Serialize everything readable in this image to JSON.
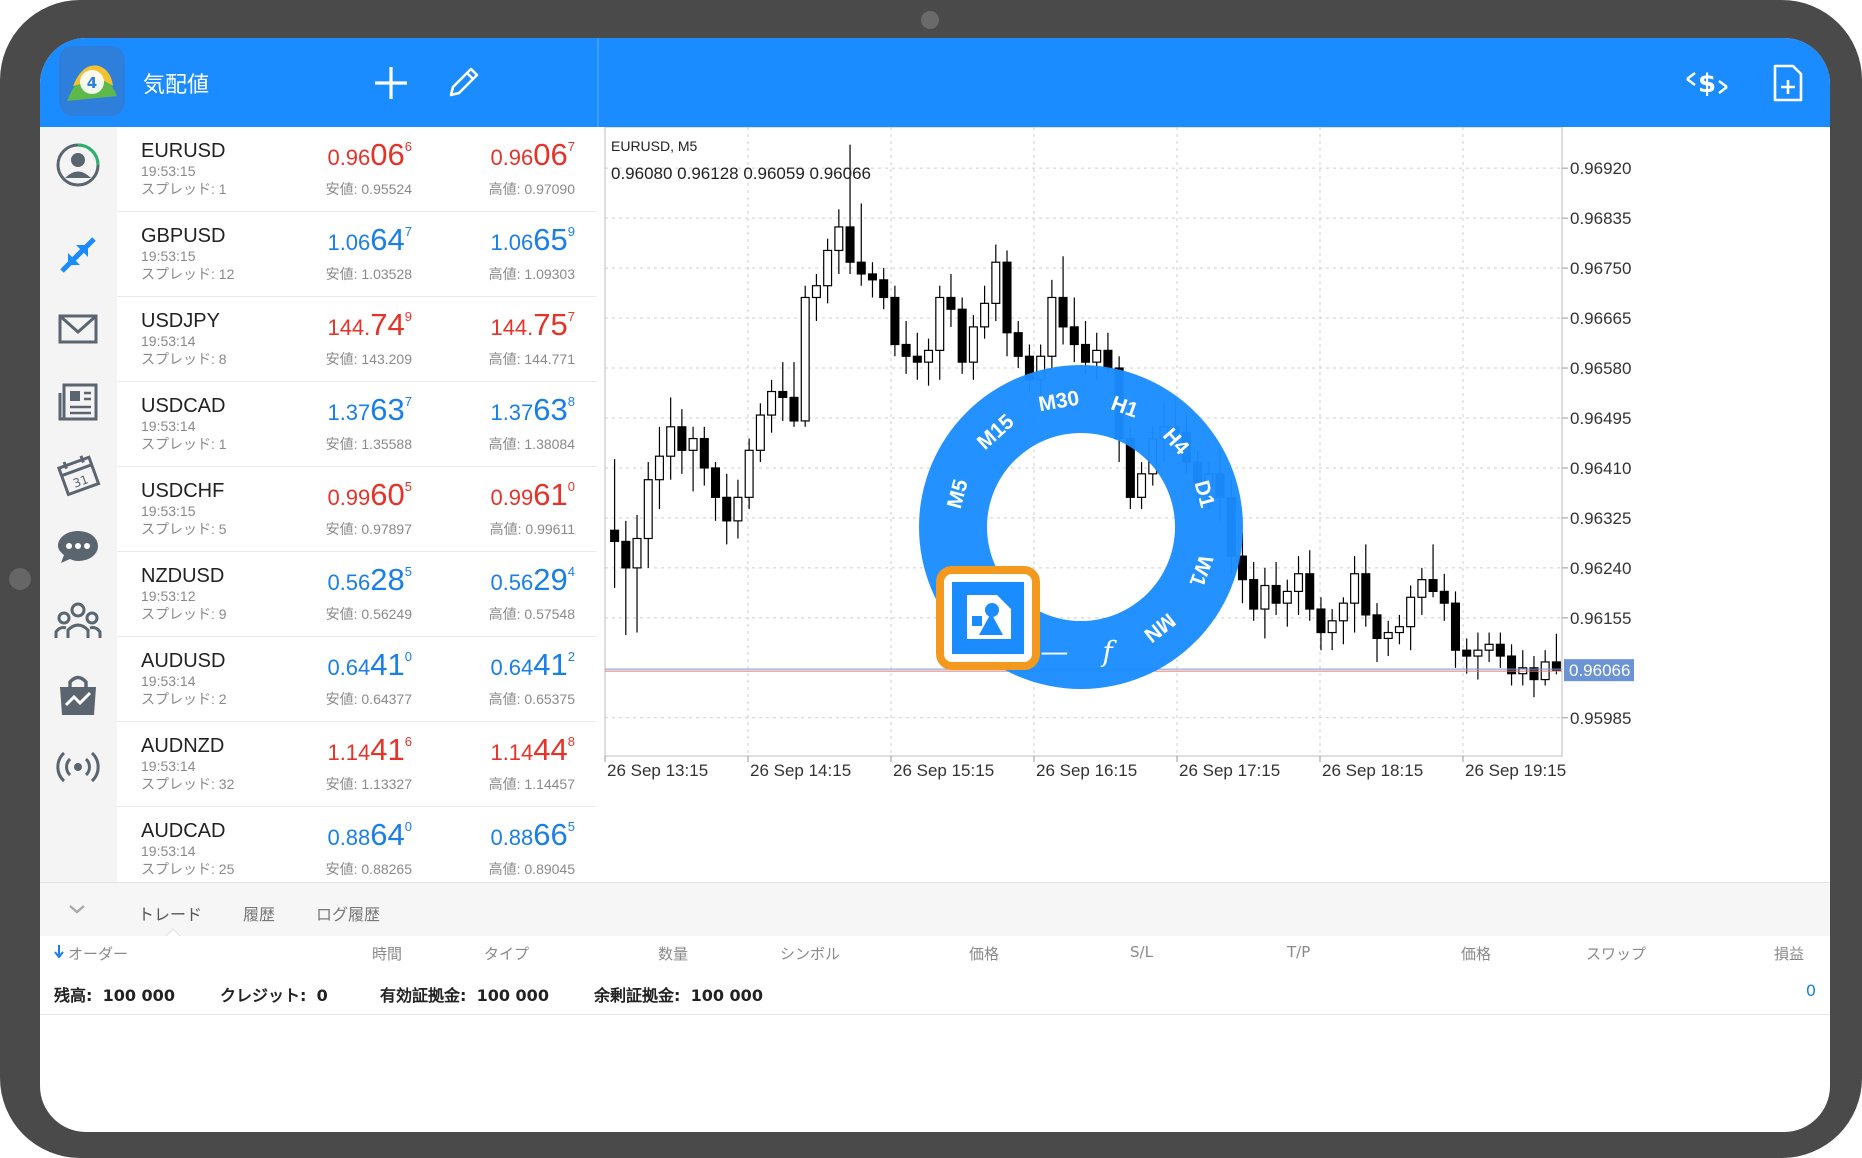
{
  "header": {
    "title": "気配値"
  },
  "quotes": [
    {
      "symbol": "EURUSD",
      "time": "19:53:15",
      "spread": "スプレッド: 1",
      "dir": "red",
      "bid": {
        "a": "0.96",
        "b": "06",
        "c": "6"
      },
      "ask": {
        "a": "0.96",
        "b": "06",
        "c": "7"
      },
      "low": "安値: 0.95524",
      "high": "高値: 0.97090"
    },
    {
      "symbol": "GBPUSD",
      "time": "19:53:15",
      "spread": "スプレッド: 12",
      "dir": "blue",
      "bid": {
        "a": "1.06",
        "b": "64",
        "c": "7"
      },
      "ask": {
        "a": "1.06",
        "b": "65",
        "c": "9"
      },
      "low": "安値: 1.03528",
      "high": "高値: 1.09303"
    },
    {
      "symbol": "USDJPY",
      "time": "19:53:14",
      "spread": "スプレッド: 8",
      "dir": "red",
      "bid": {
        "a": "144.",
        "b": "74",
        "c": "9"
      },
      "ask": {
        "a": "144.",
        "b": "75",
        "c": "7"
      },
      "low": "安値: 143.209",
      "high": "高値: 144.771"
    },
    {
      "symbol": "USDCAD",
      "time": "19:53:14",
      "spread": "スプレッド: 1",
      "dir": "blue",
      "bid": {
        "a": "1.37",
        "b": "63",
        "c": "7"
      },
      "ask": {
        "a": "1.37",
        "b": "63",
        "c": "8"
      },
      "low": "安値: 1.35588",
      "high": "高値: 1.38084"
    },
    {
      "symbol": "USDCHF",
      "time": "19:53:15",
      "spread": "スプレッド: 5",
      "dir": "red",
      "bid": {
        "a": "0.99",
        "b": "60",
        "c": "5"
      },
      "ask": {
        "a": "0.99",
        "b": "61",
        "c": "0"
      },
      "low": "安値: 0.97897",
      "high": "高値: 0.99611"
    },
    {
      "symbol": "NZDUSD",
      "time": "19:53:12",
      "spread": "スプレッド: 9",
      "dir": "blue",
      "bid": {
        "a": "0.56",
        "b": "28",
        "c": "5"
      },
      "ask": {
        "a": "0.56",
        "b": "29",
        "c": "4"
      },
      "low": "安値: 0.56249",
      "high": "高値: 0.57548"
    },
    {
      "symbol": "AUDUSD",
      "time": "19:53:14",
      "spread": "スプレッド: 2",
      "dir": "blue",
      "bid": {
        "a": "0.64",
        "b": "41",
        "c": "0"
      },
      "ask": {
        "a": "0.64",
        "b": "41",
        "c": "2"
      },
      "low": "安値: 0.64377",
      "high": "高値: 0.65375"
    },
    {
      "symbol": "AUDNZD",
      "time": "19:53:14",
      "spread": "スプレッド: 32",
      "dir": "red",
      "bid": {
        "a": "1.14",
        "b": "41",
        "c": "6"
      },
      "ask": {
        "a": "1.14",
        "b": "44",
        "c": "8"
      },
      "low": "安値: 1.13327",
      "high": "高値: 1.14457"
    },
    {
      "symbol": "AUDCAD",
      "time": "19:53:14",
      "spread": "スプレッド: 25",
      "dir": "blue",
      "bid": {
        "a": "0.88",
        "b": "64",
        "c": "0"
      },
      "ask": {
        "a": "0.88",
        "b": "66",
        "c": "5"
      },
      "low": "安値: 0.88265",
      "high": "高値: 0.89045"
    }
  ],
  "chart": {
    "symbol_label": "EURUSD, M5",
    "ohlc_label": "0.96080 0.96128 0.96059 0.96066",
    "current_price_label": "0.96066",
    "timeframes": [
      "M5",
      "M15",
      "M30",
      "H1",
      "H4",
      "D1",
      "W1",
      "MN"
    ],
    "wheel_tools": [
      "—",
      "f"
    ]
  },
  "chart_data": {
    "type": "candlestick",
    "title": "EURUSD, M5",
    "xlabel": "",
    "ylabel": "",
    "ylim": [
      0.9592,
      0.9699
    ],
    "y_ticks": [
      0.9692,
      0.96835,
      0.9675,
      0.96665,
      0.9658,
      0.96495,
      0.9641,
      0.96325,
      0.9624,
      0.96155,
      0.96066,
      0.95985
    ],
    "y_tick_labels": [
      "0.96920",
      "0.96835",
      "0.96750",
      "0.96665",
      "0.96580",
      "0.96495",
      "0.96410",
      "0.96325",
      "0.96240",
      "0.96155",
      "0.96066",
      "0.95985"
    ],
    "x_tick_labels": [
      "26 Sep 13:15",
      "26 Sep 14:15",
      "26 Sep 15:15",
      "26 Sep 16:15",
      "26 Sep 17:15",
      "26 Sep 18:15",
      "26 Sep 19:15"
    ],
    "current_price": 0.96066,
    "grid": true,
    "candles": [
      [
        0.96304,
        0.96425,
        0.96206,
        0.96285
      ],
      [
        0.96285,
        0.9632,
        0.96126,
        0.9624
      ],
      [
        0.9624,
        0.9633,
        0.9613,
        0.9629
      ],
      [
        0.9629,
        0.9642,
        0.9624,
        0.9639
      ],
      [
        0.9639,
        0.9648,
        0.9634,
        0.9643
      ],
      [
        0.9643,
        0.9653,
        0.9639,
        0.9648
      ],
      [
        0.9648,
        0.9651,
        0.964,
        0.9644
      ],
      [
        0.9644,
        0.9648,
        0.9637,
        0.9646
      ],
      [
        0.9646,
        0.9648,
        0.9638,
        0.9641
      ],
      [
        0.9641,
        0.9642,
        0.9632,
        0.9636
      ],
      [
        0.9636,
        0.964,
        0.9628,
        0.9632
      ],
      [
        0.9632,
        0.9639,
        0.9629,
        0.9636
      ],
      [
        0.9636,
        0.9646,
        0.9634,
        0.9644
      ],
      [
        0.9644,
        0.9652,
        0.9642,
        0.965
      ],
      [
        0.965,
        0.9656,
        0.9647,
        0.9654
      ],
      [
        0.9654,
        0.9659,
        0.9649,
        0.9653
      ],
      [
        0.9653,
        0.9659,
        0.9648,
        0.9649
      ],
      [
        0.9649,
        0.9672,
        0.9648,
        0.967
      ],
      [
        0.967,
        0.9674,
        0.9666,
        0.9672
      ],
      [
        0.9672,
        0.968,
        0.9669,
        0.9678
      ],
      [
        0.9678,
        0.9685,
        0.9674,
        0.9682
      ],
      [
        0.9682,
        0.9696,
        0.9674,
        0.9676
      ],
      [
        0.9676,
        0.9686,
        0.9672,
        0.9674
      ],
      [
        0.9674,
        0.9676,
        0.967,
        0.9673
      ],
      [
        0.9673,
        0.9675,
        0.9668,
        0.967
      ],
      [
        0.967,
        0.9672,
        0.966,
        0.9662
      ],
      [
        0.9662,
        0.9666,
        0.9657,
        0.966
      ],
      [
        0.966,
        0.9664,
        0.9656,
        0.9659
      ],
      [
        0.9659,
        0.9663,
        0.9655,
        0.9661
      ],
      [
        0.9661,
        0.9672,
        0.9656,
        0.967
      ],
      [
        0.967,
        0.9674,
        0.9665,
        0.9668
      ],
      [
        0.9668,
        0.967,
        0.9657,
        0.9659
      ],
      [
        0.9659,
        0.9667,
        0.9656,
        0.9665
      ],
      [
        0.9665,
        0.9672,
        0.9663,
        0.9669
      ],
      [
        0.9669,
        0.9679,
        0.9666,
        0.9676
      ],
      [
        0.9676,
        0.9678,
        0.966,
        0.9664
      ],
      [
        0.9664,
        0.9666,
        0.9658,
        0.966
      ],
      [
        0.966,
        0.9662,
        0.9654,
        0.9656
      ],
      [
        0.9656,
        0.9662,
        0.9652,
        0.966
      ],
      [
        0.966,
        0.9673,
        0.9658,
        0.967
      ],
      [
        0.967,
        0.9677,
        0.9662,
        0.9665
      ],
      [
        0.9665,
        0.967,
        0.9659,
        0.9662
      ],
      [
        0.9662,
        0.9666,
        0.9657,
        0.9659
      ],
      [
        0.9659,
        0.9664,
        0.9656,
        0.9661
      ],
      [
        0.9661,
        0.9664,
        0.9657,
        0.9658
      ],
      [
        0.9658,
        0.966,
        0.9642,
        0.9646
      ],
      [
        0.9646,
        0.9648,
        0.9634,
        0.9636
      ],
      [
        0.9636,
        0.9642,
        0.9634,
        0.964
      ],
      [
        0.964,
        0.9648,
        0.9638,
        0.9646
      ],
      [
        0.9646,
        0.9652,
        0.9642,
        0.9648
      ],
      [
        0.9648,
        0.9653,
        0.9645,
        0.9647
      ],
      [
        0.9647,
        0.965,
        0.964,
        0.9642
      ],
      [
        0.9642,
        0.9644,
        0.9635,
        0.9638
      ],
      [
        0.9638,
        0.9642,
        0.9634,
        0.964
      ],
      [
        0.964,
        0.9644,
        0.9632,
        0.9636
      ],
      [
        0.9636,
        0.9639,
        0.9623,
        0.9626
      ],
      [
        0.9626,
        0.963,
        0.9618,
        0.9622
      ],
      [
        0.9622,
        0.9625,
        0.9615,
        0.9617
      ],
      [
        0.9617,
        0.9624,
        0.9612,
        0.9621
      ],
      [
        0.9621,
        0.9625,
        0.9616,
        0.9618
      ],
      [
        0.9618,
        0.9622,
        0.9614,
        0.962
      ],
      [
        0.962,
        0.9626,
        0.9616,
        0.9623
      ],
      [
        0.9623,
        0.9627,
        0.9615,
        0.9617
      ],
      [
        0.9617,
        0.9619,
        0.961,
        0.9613
      ],
      [
        0.9613,
        0.9617,
        0.961,
        0.9615
      ],
      [
        0.9615,
        0.9619,
        0.9611,
        0.9618
      ],
      [
        0.9618,
        0.9626,
        0.9613,
        0.9623
      ],
      [
        0.9623,
        0.9628,
        0.9614,
        0.9616
      ],
      [
        0.9616,
        0.9618,
        0.9608,
        0.9612
      ],
      [
        0.9612,
        0.9615,
        0.9609,
        0.9613
      ],
      [
        0.9613,
        0.9616,
        0.9611,
        0.9614
      ],
      [
        0.9614,
        0.9621,
        0.961,
        0.9619
      ],
      [
        0.9619,
        0.9624,
        0.9616,
        0.9622
      ],
      [
        0.9622,
        0.9628,
        0.9619,
        0.962
      ],
      [
        0.962,
        0.9623,
        0.9615,
        0.9618
      ],
      [
        0.9618,
        0.962,
        0.9607,
        0.961
      ],
      [
        0.961,
        0.9612,
        0.9606,
        0.9609
      ],
      [
        0.9609,
        0.9613,
        0.9605,
        0.961
      ],
      [
        0.961,
        0.9613,
        0.9608,
        0.9611
      ],
      [
        0.9611,
        0.9613,
        0.9607,
        0.9609
      ],
      [
        0.9609,
        0.9611,
        0.9604,
        0.9606
      ],
      [
        0.9606,
        0.961,
        0.9604,
        0.9607
      ],
      [
        0.9607,
        0.9609,
        0.9602,
        0.9605
      ],
      [
        0.9605,
        0.961,
        0.9604,
        0.9608
      ],
      [
        0.9608,
        0.96128,
        0.96059,
        0.96066
      ]
    ]
  },
  "bottom": {
    "tabs": [
      "トレード",
      "履歴",
      "ログ履歴"
    ],
    "columns": [
      "オーダー",
      "時間",
      "タイプ",
      "数量",
      "シンボル",
      "価格",
      "S/L",
      "T/P",
      "価格",
      "スワップ",
      "損益"
    ],
    "summary": {
      "balance_label": "残高:",
      "balance": "100 000",
      "credit_label": "クレジット:",
      "credit": "0",
      "equity_label": "有効証拠金:",
      "equity": "100 000",
      "free_label": "余剰証拠金:",
      "free": "100 000",
      "profit": "0"
    }
  }
}
